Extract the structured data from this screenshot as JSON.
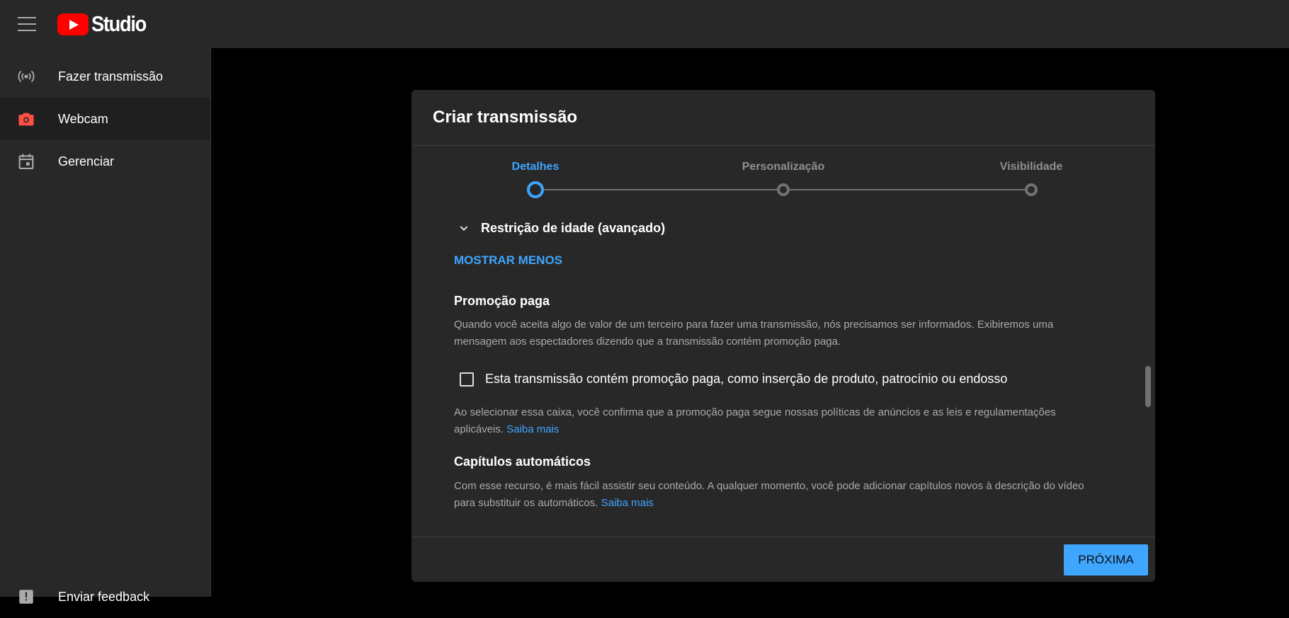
{
  "topbar": {
    "menu_icon": "hamburger-icon",
    "logo_text": "Studio",
    "logo_color": "#ff0000"
  },
  "sidebar": {
    "items": [
      {
        "label": "Fazer transmissão",
        "icon": "broadcast-icon",
        "active": false
      },
      {
        "label": "Webcam",
        "icon": "camera-icon",
        "active": true
      },
      {
        "label": "Gerenciar",
        "icon": "calendar-icon",
        "active": false
      }
    ],
    "feedback_label": "Enviar feedback"
  },
  "dialog": {
    "title": "Criar transmissão",
    "steps": [
      {
        "label": "Detalhes",
        "active": true
      },
      {
        "label": "Personalização",
        "active": false
      },
      {
        "label": "Visibilidade",
        "active": false
      }
    ],
    "age_restriction_label": "Restrição de idade (avançado)",
    "show_less_label": "MOSTRAR MENOS",
    "paid_promotion": {
      "title": "Promoção paga",
      "description": "Quando você aceita algo de valor de um terceiro para fazer uma transmissão, nós precisamos ser informados. Exibiremos uma mensagem aos espectadores dizendo que a transmissão contém promoção paga.",
      "checkbox_label": "Esta transmissão contém promoção paga, como inserção de produto, patrocínio ou endosso",
      "checkbox_checked": false,
      "note": "Ao selecionar essa caixa, você confirma que a promoção paga segue nossas políticas de anúncios e as leis e regulamentações aplicáveis.",
      "learn_more": "Saiba mais"
    },
    "auto_chapters": {
      "title": "Capítulos automáticos",
      "description": "Com esse recurso, é mais fácil assistir seu conteúdo. A qualquer momento, você pode adicionar capítulos novos à descrição do vídeo para substituir os automáticos.",
      "learn_more": "Saiba mais"
    },
    "next_label": "PRÓXIMA"
  },
  "colors": {
    "accent": "#3ea6ff",
    "panel": "#282828",
    "background": "#000000",
    "webcam_icon": "#ff4e45"
  }
}
